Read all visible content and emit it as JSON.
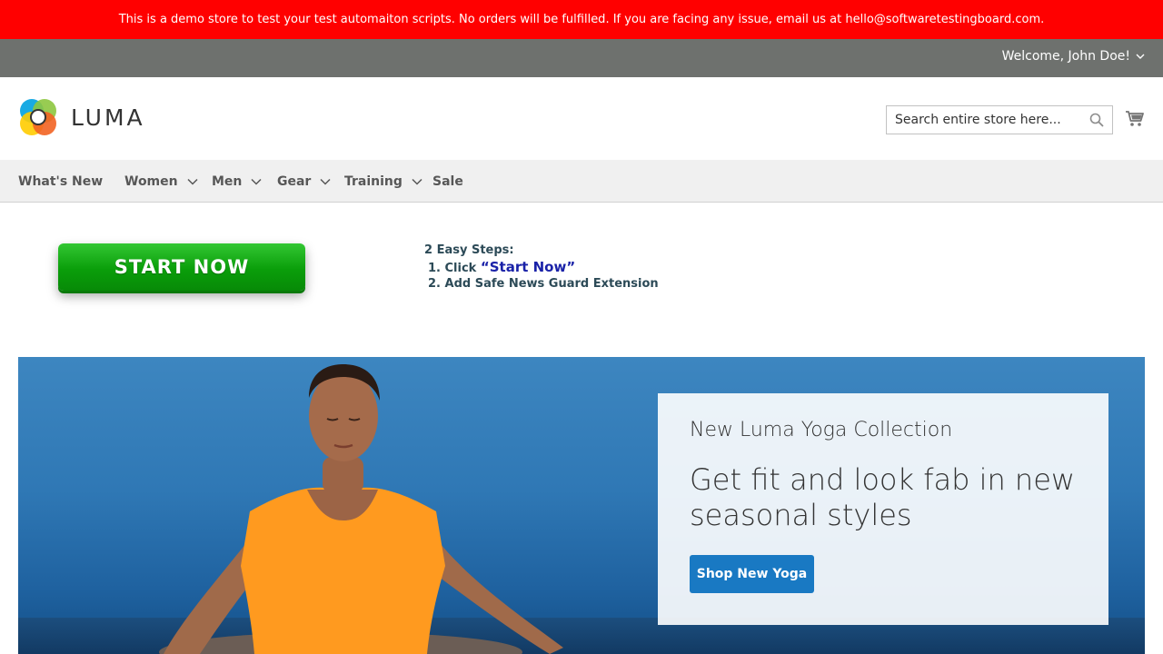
{
  "notice": {
    "text": "This is a demo store to test your test automaiton scripts. No orders will be fulfilled. If you are facing any issue, email us at hello@softwaretestingboard.com."
  },
  "header": {
    "welcome": "Welcome, John Doe!"
  },
  "logo": {
    "text": "LUMA",
    "colors": [
      "#f26322",
      "#00a1e0",
      "#8dc63f",
      "#ffcc00"
    ]
  },
  "search": {
    "placeholder": "Search entire store here...",
    "value": ""
  },
  "nav": {
    "items": [
      {
        "label": "What's New",
        "dropdown": false
      },
      {
        "label": "Women",
        "dropdown": true
      },
      {
        "label": "Men",
        "dropdown": true
      },
      {
        "label": "Gear",
        "dropdown": true
      },
      {
        "label": "Training",
        "dropdown": true
      },
      {
        "label": "Sale",
        "dropdown": false
      }
    ]
  },
  "ad": {
    "button_label": "START NOW",
    "steps_title": "2 Easy Steps:",
    "step1_prefix": "1. Click",
    "step1_highlight": "“Start Now”",
    "step2": "2. Add Safe News Guard Extension"
  },
  "hero": {
    "subtitle": "New Luma Yoga Collection",
    "title": "Get fit and look fab in new seasonal styles",
    "button_label": "Shop New Yoga"
  },
  "colors": {
    "notice_bg": "#ff0000",
    "panel_bg": "#6e716e",
    "nav_bg": "#f0f0f0",
    "primary_button": "#1979c3",
    "start_button": "#0a9e0a"
  }
}
